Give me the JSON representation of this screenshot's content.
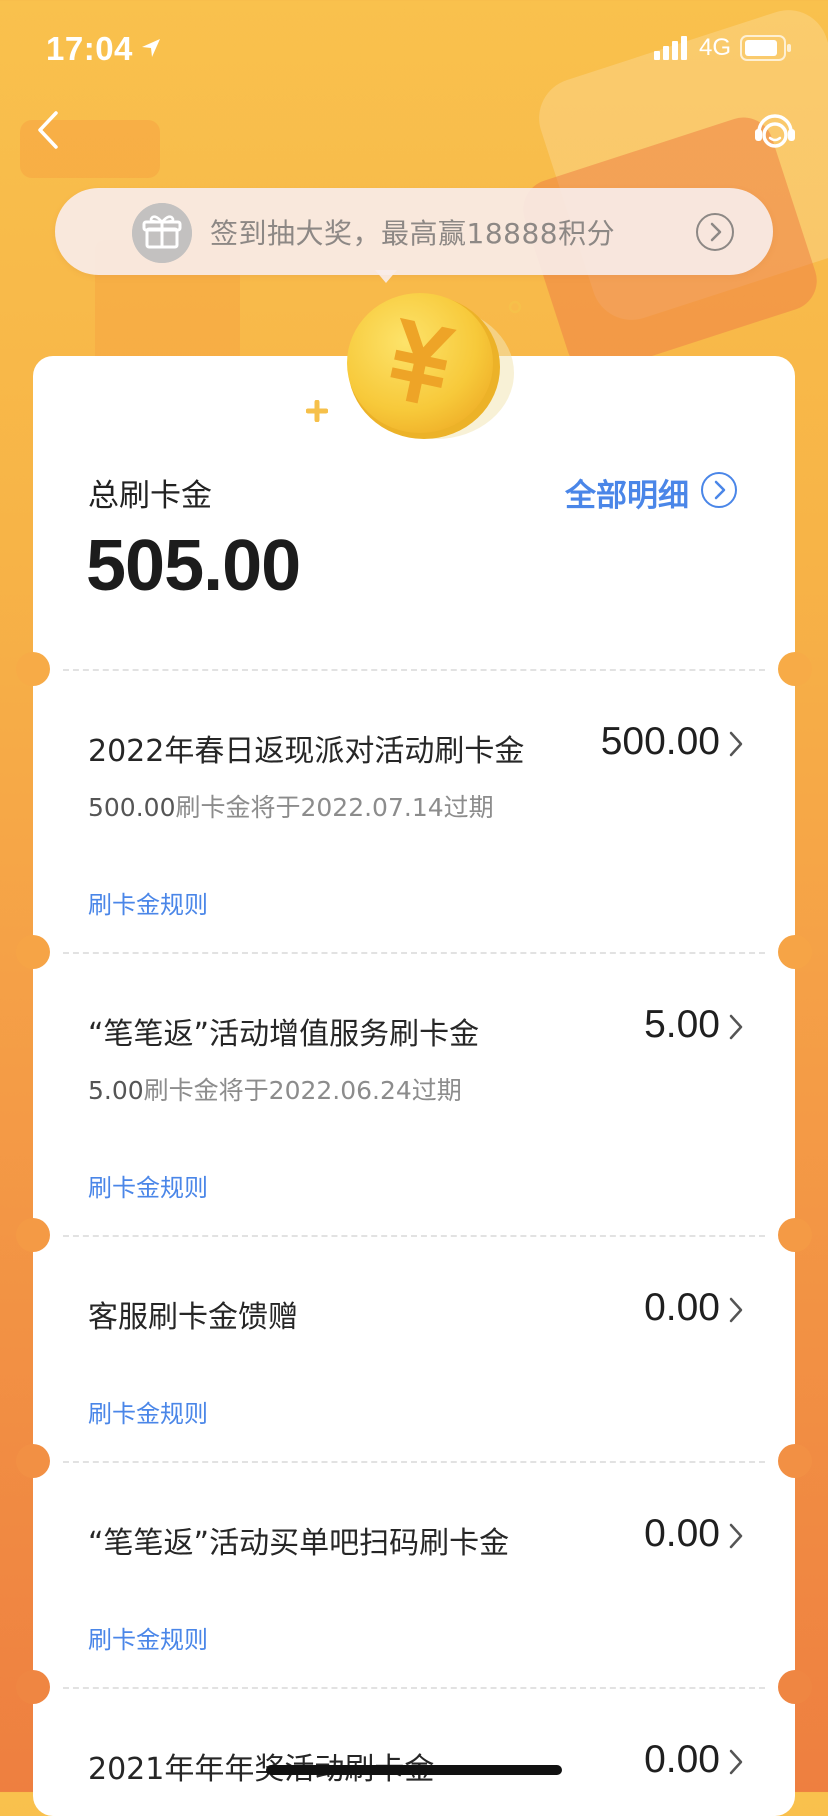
{
  "status_bar": {
    "time": "17:04",
    "network": "4G"
  },
  "banner": {
    "text": "签到抽大奖，最高赢18888积分"
  },
  "summary": {
    "label": "总刷卡金",
    "amount": "505.00",
    "detail_link": "全部明细"
  },
  "items": [
    {
      "title": "2022年春日返现派对活动刷卡金",
      "amount": "500.00",
      "sub_amount": "500.00",
      "sub_text": "刷卡金将于2022.07.14过期",
      "rule": "刷卡金规则"
    },
    {
      "title": "“笔笔返”活动增值服务刷卡金",
      "amount": "5.00",
      "sub_amount": "5.00",
      "sub_text": "刷卡金将于2022.06.24过期",
      "rule": "刷卡金规则"
    },
    {
      "title": "客服刷卡金馈赠",
      "amount": "0.00",
      "rule": "刷卡金规则"
    },
    {
      "title": "“笔笔返”活动买单吧扫码刷卡金",
      "amount": "0.00",
      "rule": "刷卡金规则"
    },
    {
      "title": "2021年年年奖活动刷卡金",
      "amount": "0.00"
    }
  ],
  "colors": {
    "accent_blue": "#4a86e8",
    "coin_yellow": "#f7c93a",
    "background_orange": "#f5a047"
  }
}
